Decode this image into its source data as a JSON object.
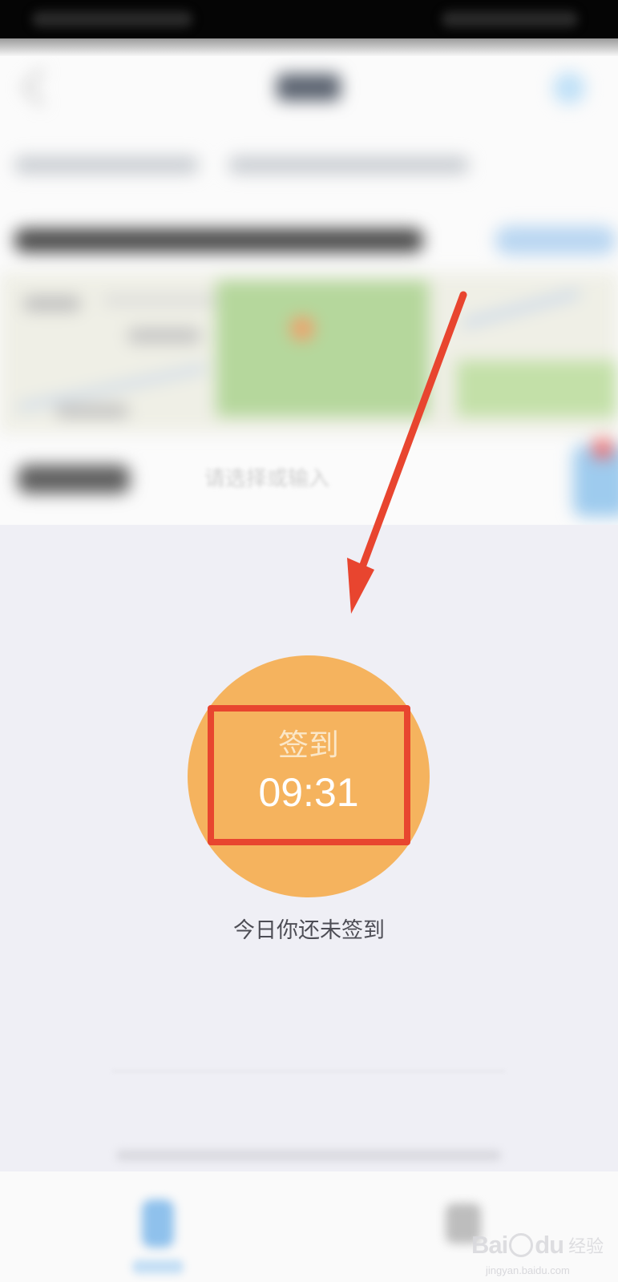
{
  "app": {
    "background_color": "#efeff5",
    "accent_color": "#f5b35e",
    "annotation_color": "#e8452f"
  },
  "form": {
    "field_placeholder": "请选择或输入"
  },
  "checkin": {
    "label": "签到",
    "time": "09:31",
    "status_text": "今日你还未签到"
  },
  "watermark": {
    "brand": "Bai",
    "brand_suffix": "du",
    "cn": "经验",
    "url": "jingyan.baidu.com"
  },
  "icons": {
    "back": "back-arrow-icon",
    "nav_action": "nav-action-icon",
    "location_pin": "location-pin-icon",
    "annotation_arrow": "red-arrow-icon",
    "tab_checkin": "tab-checkin-icon",
    "tab_stats": "tab-stats-icon",
    "watermark_paw": "paw-icon"
  }
}
